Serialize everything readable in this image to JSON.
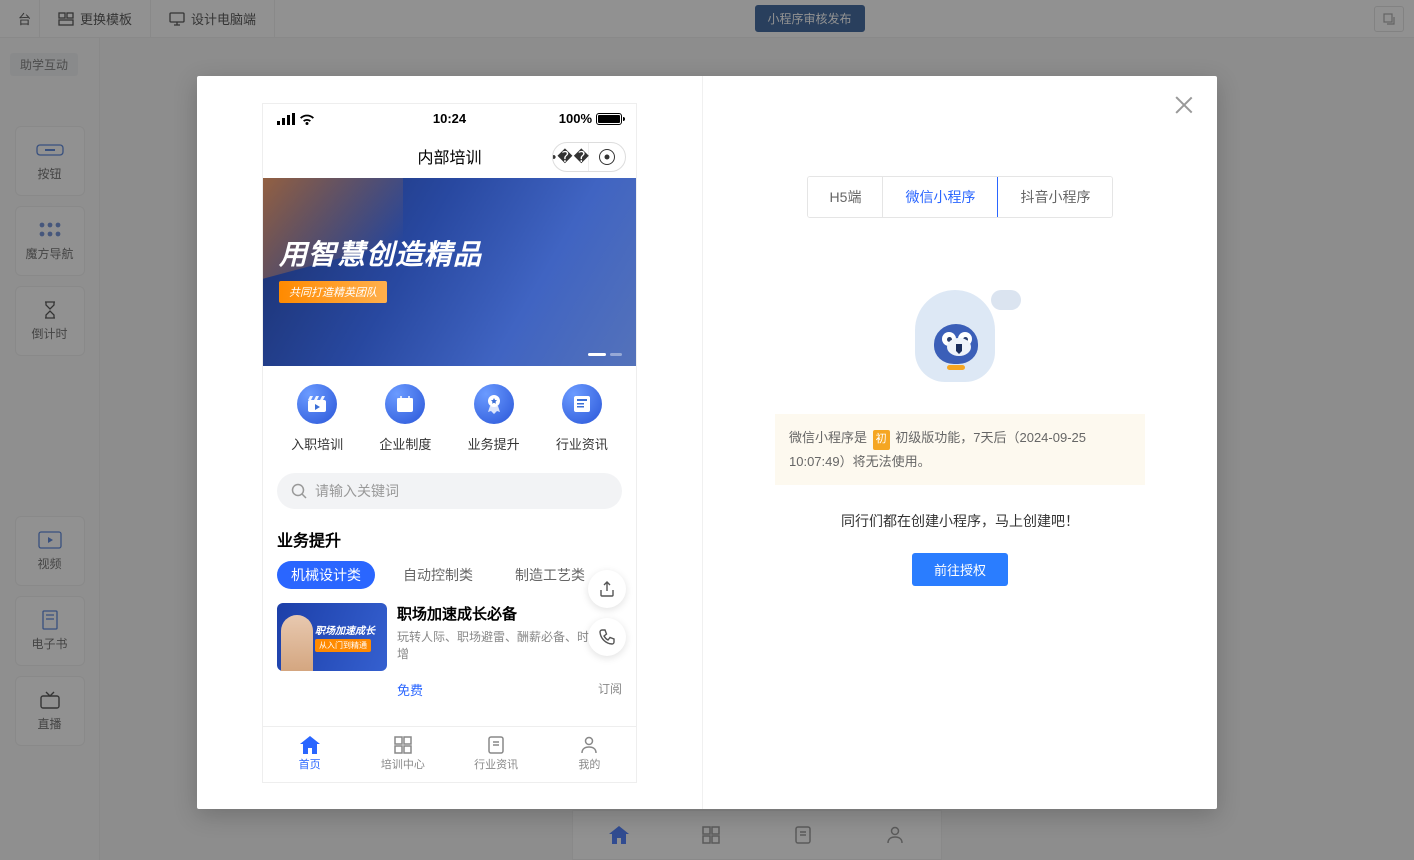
{
  "topbar": {
    "tab_first": "台",
    "change_template": "更换模板",
    "design_desktop": "设计电脑端",
    "publish_btn": "小程序审核发布"
  },
  "sidebar": {
    "group_tag": "助学互动",
    "items": [
      {
        "label": "按钮"
      },
      {
        "label": "魔方导航"
      },
      {
        "label": "倒计时"
      }
    ],
    "items2": [
      {
        "label": "视频"
      },
      {
        "label": "电子书"
      },
      {
        "label": "直播"
      }
    ]
  },
  "phone": {
    "status": {
      "time": "10:24",
      "battery": "100%"
    },
    "header_title": "内部培训",
    "banner": {
      "title": "用智慧创造精品",
      "subtitle": "共同打造精英团队"
    },
    "nav": [
      {
        "label": "入职培训"
      },
      {
        "label": "企业制度"
      },
      {
        "label": "业务提升"
      },
      {
        "label": "行业资讯"
      }
    ],
    "search_placeholder": "请输入关键词",
    "section_title": "业务提升",
    "chips": [
      {
        "label": "机械设计类",
        "on": true
      },
      {
        "label": "自动控制类",
        "on": false
      },
      {
        "label": "制造工艺类",
        "on": false
      }
    ],
    "course": {
      "img_l1": "职场加速成长",
      "img_l2": "从入门到精通",
      "title": "职场加速成长必备",
      "desc": "玩转人际、职场避雷、酬薪必备、时间倍增",
      "price": "免费",
      "subscribe": "订阅"
    },
    "tabbar": [
      {
        "label": "首页",
        "on": true
      },
      {
        "label": "培训中心",
        "on": false
      },
      {
        "label": "行业资讯",
        "on": false
      },
      {
        "label": "我的",
        "on": false
      }
    ]
  },
  "right": {
    "tabs": [
      {
        "label": "H5端",
        "on": false
      },
      {
        "label": "微信小程序",
        "on": true
      },
      {
        "label": "抖音小程序",
        "on": false
      }
    ],
    "notice_pre": "微信小程序是",
    "notice_tag": "初",
    "notice_post": "初级版功能，7天后（2024-09-25 10:07:49）将无法使用。",
    "cta_text": "同行们都在创建小程序，马上创建吧！",
    "cta_btn": "前往授权"
  }
}
